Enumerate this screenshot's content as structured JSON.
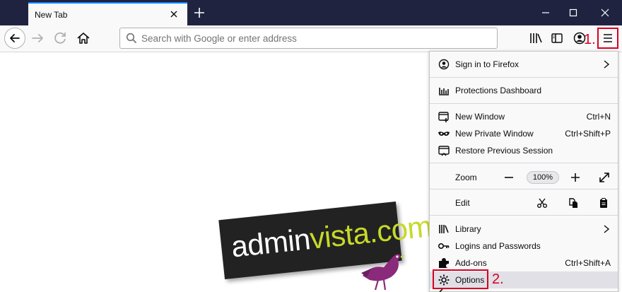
{
  "tab": {
    "title": "New Tab"
  },
  "urlbar": {
    "placeholder": "Search with Google or enter address"
  },
  "annotations": {
    "step1": "1.",
    "step2": "2."
  },
  "menu": {
    "sign_in": "Sign in to Firefox",
    "protections": "Protections Dashboard",
    "new_window": {
      "label": "New Window",
      "shortcut": "Ctrl+N"
    },
    "new_private": {
      "label": "New Private Window",
      "shortcut": "Ctrl+Shift+P"
    },
    "restore": "Restore Previous Session",
    "zoom": {
      "label": "Zoom",
      "value": "100%"
    },
    "edit": "Edit",
    "library": "Library",
    "logins": "Logins and Passwords",
    "addons": {
      "label": "Add-ons",
      "shortcut": "Ctrl+Shift+A"
    },
    "options": "Options"
  },
  "watermark": {
    "admin": "admin",
    "vista": "vista.com"
  },
  "colors": {
    "tabstrip": "#202340",
    "accent": "#0a84ff",
    "highlight": "#d70022",
    "logo_green": "#c7d92a",
    "bird": "#8a2a7a"
  }
}
